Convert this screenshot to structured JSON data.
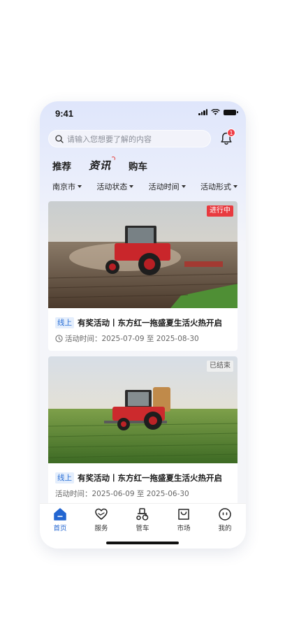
{
  "status_bar": {
    "time": "9:41",
    "icons": [
      "signal-icon",
      "wifi-icon",
      "battery-icon"
    ]
  },
  "search": {
    "placeholder": "请输入您想要了解的内容",
    "icon": "search-icon"
  },
  "notifications": {
    "icon": "bell-icon",
    "badge_count": "1"
  },
  "tabs": [
    {
      "label": "推荐",
      "active": false
    },
    {
      "label": "资讯",
      "active": true
    },
    {
      "label": "购车",
      "active": false
    }
  ],
  "filters": [
    {
      "label": "南京市"
    },
    {
      "label": "活动状态"
    },
    {
      "label": "活动时间"
    },
    {
      "label": "活动形式"
    }
  ],
  "cards": [
    {
      "status": "进行中",
      "status_color": "#e83a3f",
      "type_tag": "线上",
      "title": "有奖活动丨东方红一拖盛夏生活火热开启",
      "time_label": "活动时间：",
      "time_value": "2025-07-09 至 2025-08-30",
      "image": "red-tractor-plowing-field"
    },
    {
      "status": "已结束",
      "status_color": "#f0f0f0",
      "type_tag": "线上",
      "title": "有奖活动丨东方红一拖盛夏生活火热开启",
      "time_label": "活动时间：",
      "time_value": "2025-06-09 至 2025-06-30",
      "image": "tractor-spraying-crop-field"
    }
  ],
  "bottom_nav": [
    {
      "label": "首页",
      "icon": "home-icon",
      "active": true
    },
    {
      "label": "服务",
      "icon": "heart-hand-icon",
      "active": false
    },
    {
      "label": "管车",
      "icon": "tractor-icon",
      "active": false
    },
    {
      "label": "市场",
      "icon": "shopping-bag-icon",
      "active": false
    },
    {
      "label": "我的",
      "icon": "profile-icon",
      "active": false
    }
  ],
  "colors": {
    "accent": "#2366d1",
    "badge": "#ef3b45",
    "ongoing": "#e83a3f"
  }
}
